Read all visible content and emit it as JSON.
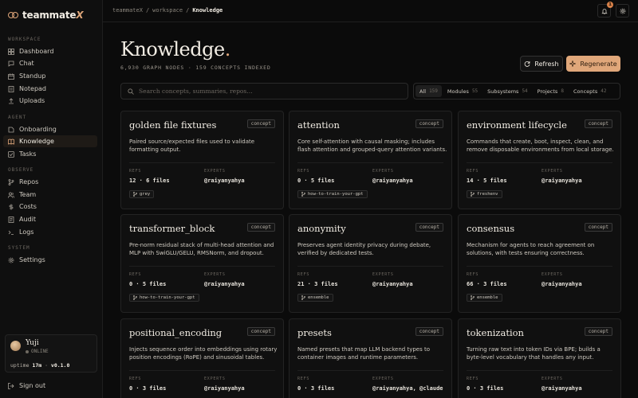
{
  "brand": {
    "name_main": "teammate",
    "name_x": "X"
  },
  "sidebar": {
    "sections": [
      {
        "label": "WORKSPACE",
        "items": [
          {
            "label": "Dashboard",
            "icon": "grid-icon"
          },
          {
            "label": "Chat",
            "icon": "chat-icon"
          },
          {
            "label": "Standup",
            "icon": "calendar-icon"
          },
          {
            "label": "Notepad",
            "icon": "note-icon"
          },
          {
            "label": "Uploads",
            "icon": "upload-icon"
          }
        ]
      },
      {
        "label": "AGENT",
        "items": [
          {
            "label": "Onboarding",
            "icon": "onboarding-icon"
          },
          {
            "label": "Knowledge",
            "icon": "book-icon",
            "active": true
          },
          {
            "label": "Tasks",
            "icon": "tasks-icon"
          }
        ]
      },
      {
        "label": "OBSERVE",
        "items": [
          {
            "label": "Repos",
            "icon": "branch-icon"
          },
          {
            "label": "Team",
            "icon": "team-icon"
          },
          {
            "label": "Costs",
            "icon": "costs-icon"
          },
          {
            "label": "Audit",
            "icon": "audit-icon"
          },
          {
            "label": "Logs",
            "icon": "terminal-icon"
          }
        ]
      },
      {
        "label": "SYSTEM",
        "items": [
          {
            "label": "Settings",
            "icon": "gear-icon"
          }
        ]
      }
    ],
    "user": {
      "name": "Yuji",
      "status": "ONLINE",
      "uptime_label": "uptime",
      "uptime_value": "17m",
      "version": "v0.1.0"
    },
    "signout_label": "Sign out"
  },
  "topbar": {
    "breadcrumb": [
      "teammateX",
      "workspace",
      "Knowledge"
    ],
    "separator": "/",
    "notification_count": "1"
  },
  "header": {
    "title": "Knowledge",
    "title_dot": ".",
    "subtitle": "6,930 GRAPH NODES · 159 CONCEPTS INDEXED",
    "refresh_label": "Refresh",
    "regenerate_label": "Regenerate"
  },
  "search": {
    "placeholder": "Search concepts, summaries, repos…"
  },
  "filters": [
    {
      "label": "All",
      "count": "159",
      "active": true
    },
    {
      "label": "Modules",
      "count": "55"
    },
    {
      "label": "Subsystems",
      "count": "54"
    },
    {
      "label": "Projects",
      "count": "8"
    },
    {
      "label": "Concepts",
      "count": "42"
    }
  ],
  "card_labels": {
    "refs": "REFS",
    "experts": "EXPERTS"
  },
  "cards": [
    {
      "title": "golden file fixtures",
      "tag": "concept",
      "desc": "Paired source/expected files used to validate formatting output.",
      "refs": "12 · 6 files",
      "experts": "@raiyanyahya",
      "repo": "grey"
    },
    {
      "title": "attention",
      "tag": "concept",
      "desc": "Core self-attention with causal masking; includes flash attention and grouped-query attention variants.",
      "refs": "0 · 5 files",
      "experts": "@raiyanyahya",
      "repo": "how-to-train-your-gpt"
    },
    {
      "title": "environment lifecycle",
      "tag": "concept",
      "desc": "Commands that create, boot, inspect, clean, and remove disposable environments from local storage.",
      "refs": "14 · 5 files",
      "experts": "@raiyanyahya",
      "repo": "freshenv"
    },
    {
      "title": "transformer_block",
      "tag": "concept",
      "desc": "Pre-norm residual stack of multi-head attention and MLP with SwiGLU/GELU, RMSNorm, and dropout.",
      "refs": "0 · 5 files",
      "experts": "@raiyanyahya",
      "repo": "how-to-train-your-gpt"
    },
    {
      "title": "anonymity",
      "tag": "concept",
      "desc": "Preserves agent identity privacy during debate, verified by dedicated tests.",
      "refs": "21 · 3 files",
      "experts": "@raiyanyahya",
      "repo": "ensemble"
    },
    {
      "title": "consensus",
      "tag": "concept",
      "desc": "Mechanism for agents to reach agreement on solutions, with tests ensuring correctness.",
      "refs": "66 · 3 files",
      "experts": "@raiyanyahya",
      "repo": "ensemble"
    },
    {
      "title": "positional_encoding",
      "tag": "concept",
      "desc": "Injects sequence order into embeddings using rotary position encodings (RoPE) and sinusoidal tables.",
      "refs": "0 · 3 files",
      "experts": "@raiyanyahya",
      "repo": ""
    },
    {
      "title": "presets",
      "tag": "concept",
      "desc": "Named presets that map LLM backend types to container images and runtime parameters.",
      "refs": "0 · 3 files",
      "experts": "@raiyanyahya, @claude",
      "repo": ""
    },
    {
      "title": "tokenization",
      "tag": "concept",
      "desc": "Turning raw text into token IDs via BPE; builds a byte-level vocabulary that handles any input.",
      "refs": "0 · 3 files",
      "experts": "@raiyanyahya",
      "repo": ""
    }
  ]
}
